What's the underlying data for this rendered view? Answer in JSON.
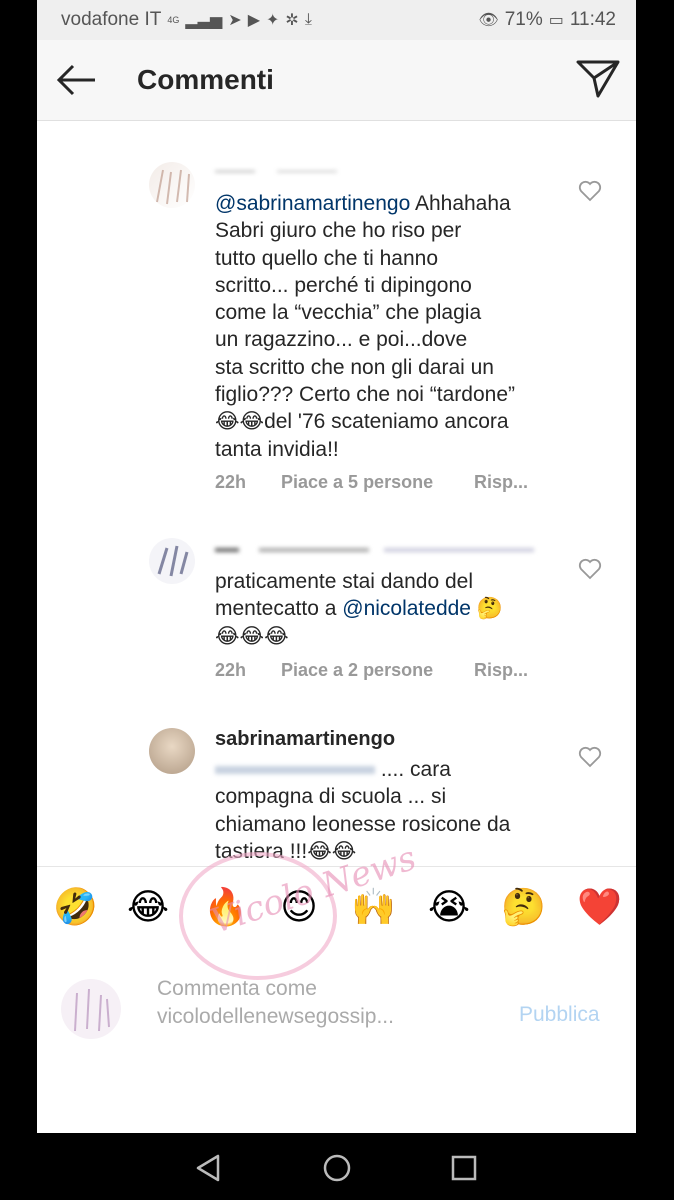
{
  "status": {
    "carrier": "vodafone IT",
    "network": "4G",
    "battery": "71%",
    "time": "11:42"
  },
  "header": {
    "title": "Commenti",
    "back_icon": "arrow-left-icon",
    "send_icon": "paper-plane-icon"
  },
  "comments": [
    {
      "username": "",
      "mention": "@sabrinamartinengo",
      "text_lines": [
        "Ahhahaha",
        "Sabri giuro che ho riso per",
        "tutto quello che ti hanno",
        "scritto... perché ti dipingono",
        "come la “vecchia” che plagia",
        "un ragazzino... e poi...dove",
        "sta scritto che non gli darai un",
        "figlio??? Certo che noi “tardone”",
        "😂😂del '76 scateniamo ancora",
        "tanta invidia!!"
      ],
      "time": "22h",
      "likes": "Piace a 5 persone",
      "reply": "Risp..."
    },
    {
      "username": "",
      "text_lines": [
        "praticamente stai dando del",
        "mentecatto a"
      ],
      "mention": "@nicolatedde",
      "text_after": "🤔",
      "text_last": "😂😂😂",
      "time": "22h",
      "likes": "Piace a 2 persone",
      "reply": "Risp..."
    },
    {
      "username": "sabrinamartinengo",
      "text_first": ".... cara",
      "text_lines": [
        "compagna di scuola ... si",
        "chiamano leonesse rosicone da",
        "tastiera !!!😂😂"
      ]
    }
  ],
  "emoji_bar": [
    "🤣",
    "😂",
    "🔥",
    "😊",
    "🙌",
    "😭",
    "🤔",
    "❤️"
  ],
  "composer": {
    "placeholder_line1": "Commenta come",
    "placeholder_line2": "vicolodellenewsegossip...",
    "publish": "Pubblica"
  },
  "watermark": "Vicolo News",
  "colors": {
    "mention": "#003569",
    "meta": "#999999",
    "publish": "#b3d4f2"
  }
}
